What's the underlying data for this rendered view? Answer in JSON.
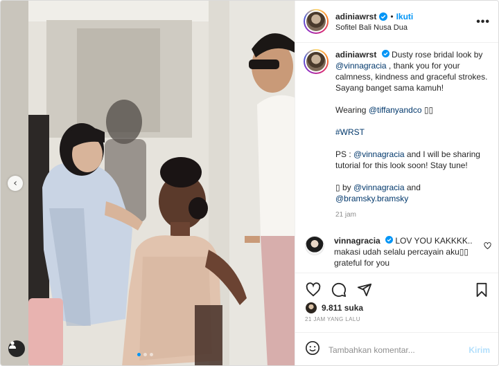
{
  "post": {
    "image": {
      "carousel_prev_glyph": "‹",
      "slide_count": 3,
      "active_slide": 1
    },
    "header": {
      "username": "adiniawrst",
      "separator": "•",
      "follow_label": "Ikuti",
      "location": "Sofitel Bali Nusa Dua",
      "more_glyph": "•••"
    },
    "caption": {
      "username": "adiniawrst",
      "line1_text": " Dusty rose bridal look by ",
      "mention_vinna": "@vinnagracia",
      "line1_rest": " , thank you for your calmness, kindness and graceful strokes. Sayang banget sama kamuh!",
      "wearing_prefix": "Wearing ",
      "mention_tiffany": "@tiffanyandco",
      "wearing_suffix": " ▯▯",
      "hashtag": "#WRST",
      "ps_prefix": "PS : ",
      "ps_mention": "@vinnagracia",
      "ps_rest": " and I will be sharing tutorial for this look soon! Stay tune!",
      "credit_prefix": "▯ by ",
      "credit_mention1": "@vinnagracia",
      "credit_and": " and ",
      "credit_mention2": "@bramsky.bramsky",
      "time": "21 jam"
    },
    "comment": {
      "username": "vinnagracia",
      "text": " LOV YOU KAKKKK.. makasi udah selalu percayain aku▯▯ grateful for you"
    },
    "likes": {
      "count_label": "9.811 suka"
    },
    "posted_time": "21 JAM YANG LALU",
    "comment_bar": {
      "placeholder": "Tambahkan komentar...",
      "post_label": "Kirim"
    },
    "colors": {
      "accent": "#0095f6",
      "mention": "#00376b",
      "muted": "#8e8e8e",
      "post_disabled": "#b2dffc"
    }
  }
}
